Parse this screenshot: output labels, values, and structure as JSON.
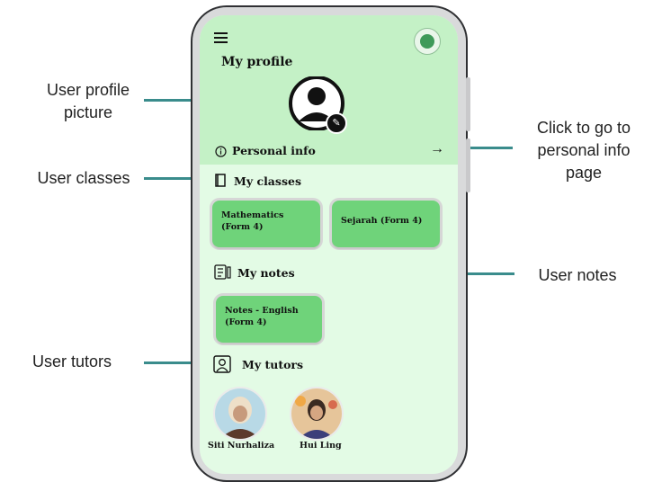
{
  "callouts": {
    "profile_picture": "User profile\npicture",
    "classes": "User classes",
    "notes": "User notes",
    "tutors": "User tutors",
    "personal_info": "Click to go to\npersonal info\npage"
  },
  "screen": {
    "title": "My profile",
    "personal_info_label": "Personal info",
    "personal_info_arrow": "→",
    "edit_glyph": "✎",
    "classes_heading": "My classes",
    "classes": [
      {
        "label": "Mathematics\n(Form 4)"
      },
      {
        "label": "Sejarah (Form 4)"
      }
    ],
    "notes_heading": "My notes",
    "notes": [
      {
        "label": "Notes - English\n(Form 4)"
      }
    ],
    "tutors_heading": "My tutors",
    "tutors": [
      {
        "name": "Siti Nurhaliza"
      },
      {
        "name": "Hui Ling"
      }
    ]
  },
  "colors": {
    "callout_line": "#3a8c8c",
    "screen_header": "#c4f1c6",
    "screen_body": "#e3fbe5",
    "card": "#6fd37a"
  },
  "icons": [
    "menu-icon",
    "logo-icon",
    "user-avatar-icon",
    "edit-icon",
    "info-icon",
    "arrow-right-icon",
    "book-icon",
    "notes-icon",
    "tutor-icon"
  ]
}
